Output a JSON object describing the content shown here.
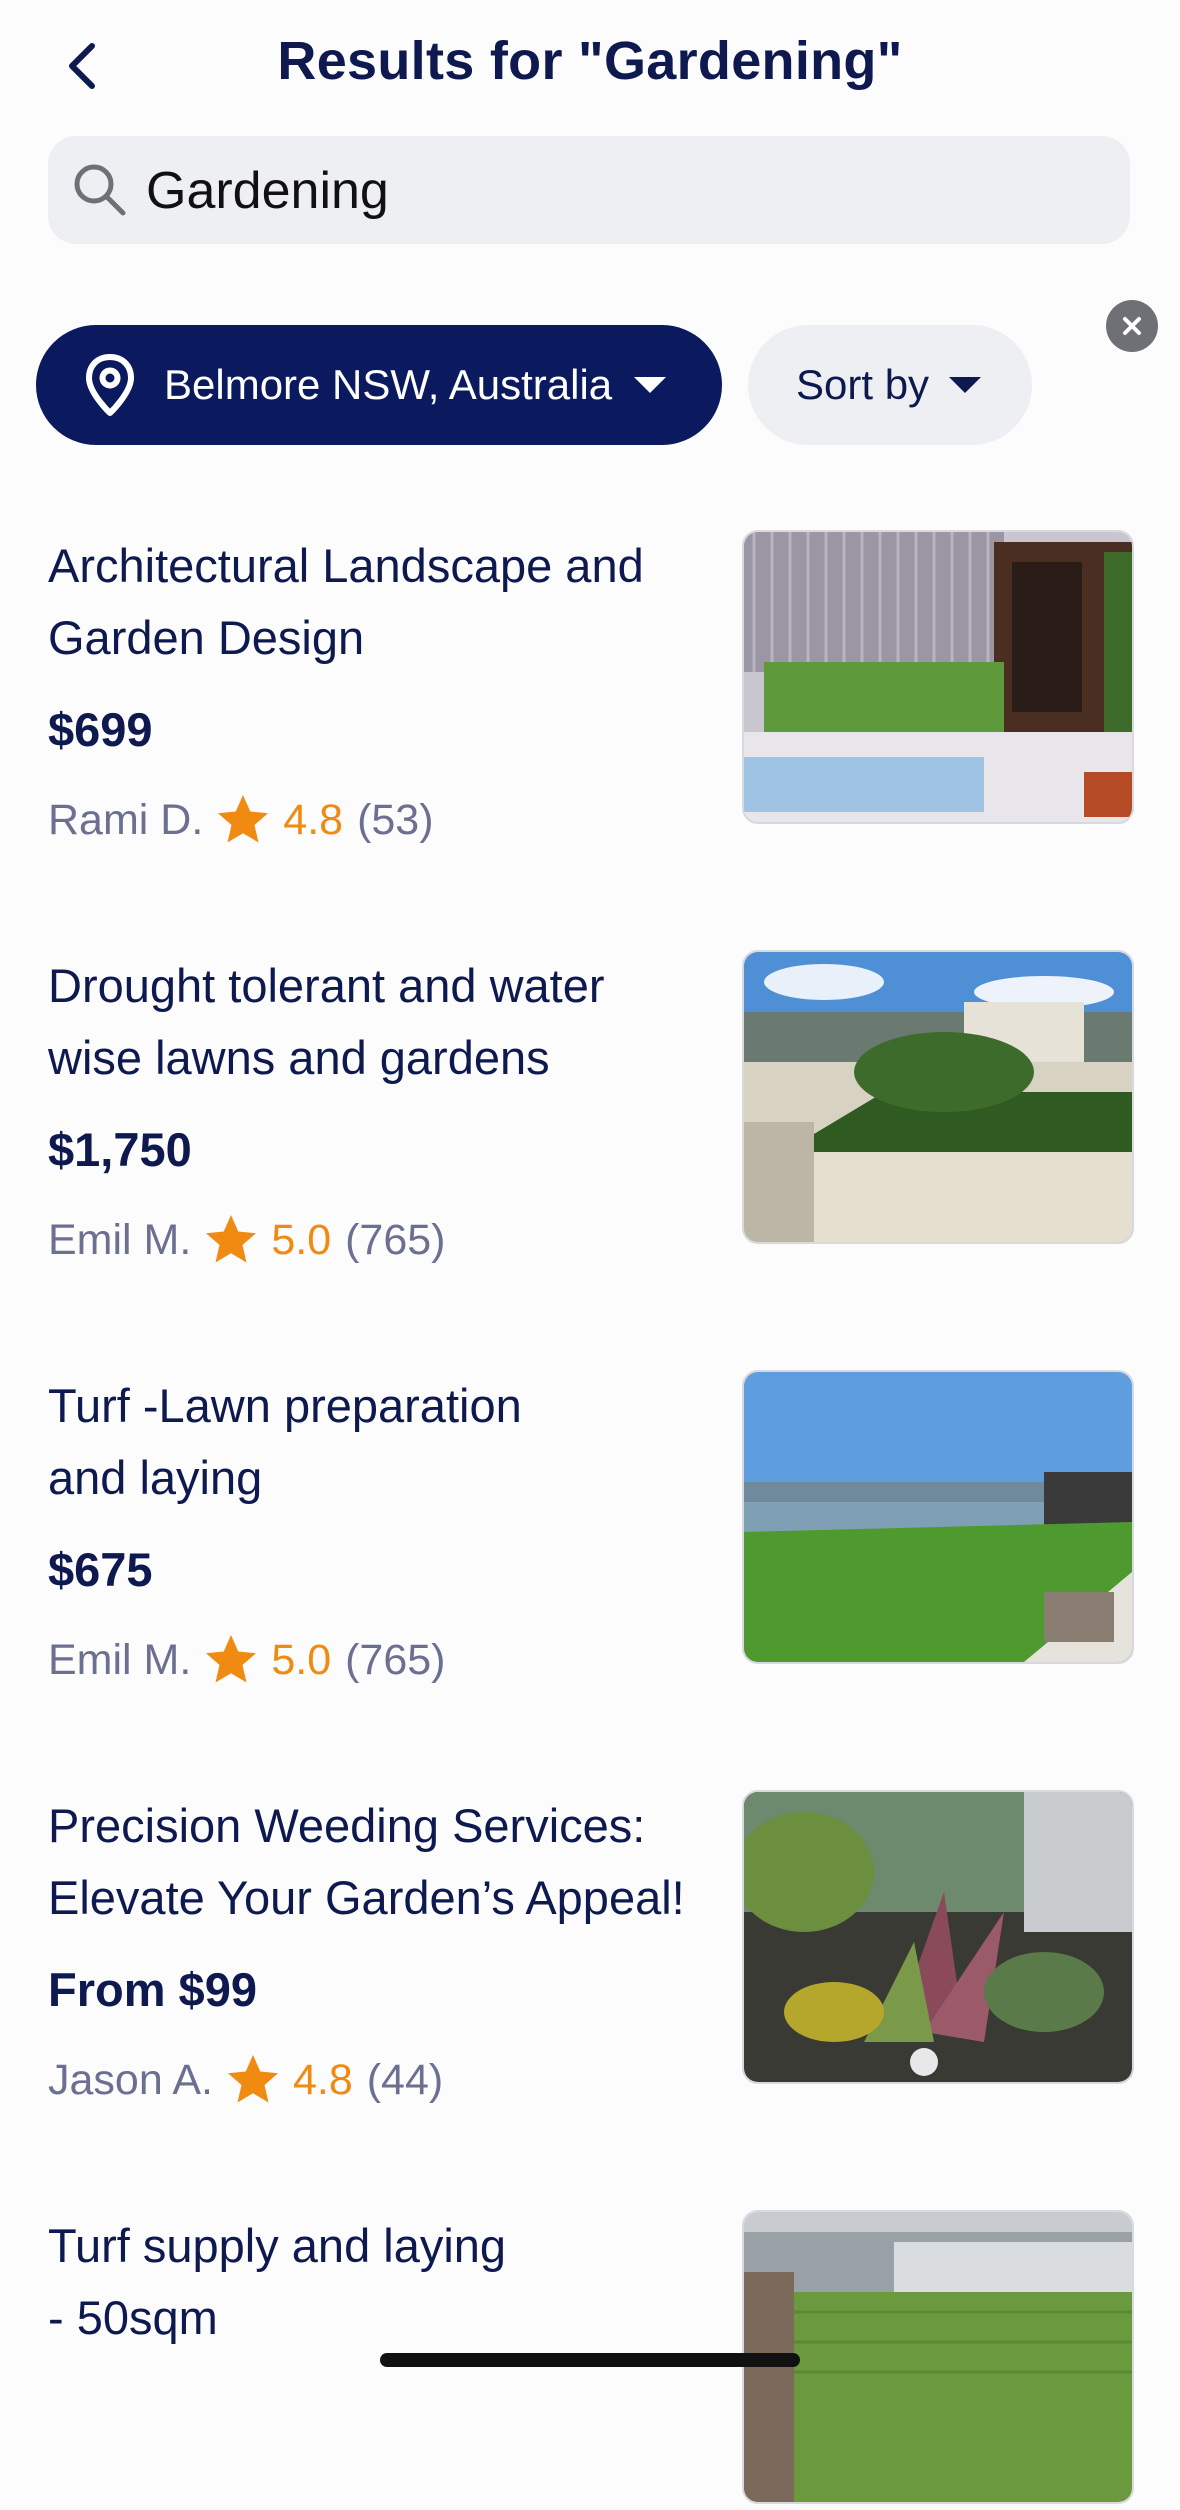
{
  "header": {
    "title": "Results for \"Gardening\""
  },
  "search": {
    "value": "Gardening"
  },
  "filters": {
    "location": "Belmore NSW, Australia",
    "sort_label": "Sort by"
  },
  "listings": [
    {
      "title": "Architectural Landscape and\nGarden Design",
      "price": "$699",
      "provider": "Rami  D.",
      "rating": "4.8",
      "count": "(53)"
    },
    {
      "title": "Drought tolerant and water\nwise  lawns and gardens",
      "price": "$1,750",
      "provider": "Emil M.",
      "rating": "5.0",
      "count": "(765)"
    },
    {
      "title": "Turf -Lawn preparation\nand laying",
      "price": "$675",
      "provider": "Emil M.",
      "rating": "5.0",
      "count": "(765)"
    },
    {
      "title": "Precision Weeding Services:\nElevate Your Garden’s Appeal!",
      "price": "From $99",
      "provider": "Jason A.",
      "rating": "4.8",
      "count": "(44)"
    },
    {
      "title": "Turf supply and laying\n- 50sqm",
      "price": "",
      "provider": "",
      "rating": "",
      "count": ""
    }
  ],
  "colors": {
    "navy": "#0b1a5e",
    "star": "#f08a10",
    "muted": "#6b7090"
  },
  "icons": [
    "back-chevron-icon",
    "search-icon",
    "clear-icon",
    "location-pin-icon",
    "caret-down-icon",
    "star-icon"
  ]
}
